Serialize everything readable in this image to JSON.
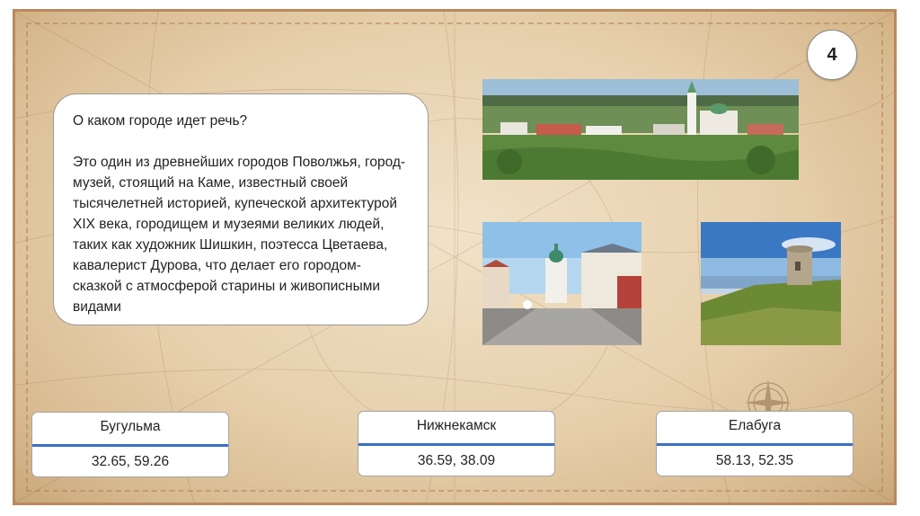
{
  "slide": {
    "number": "4",
    "question": {
      "title": "О каком городе идет речь?",
      "text": "Это один из древнейших городов Поволжья, город-музей, стоящий на Каме, известный своей тысячелетней историей, купеческой архитектурой XIX века, городищем и музеями великих людей, таких как художник Шишкин, поэтесса Цветаева, кавалерист Дурова, что делает его городом-сказкой с атмосферой старины и живописными видами"
    },
    "answers": [
      {
        "name": "Бугульма",
        "coords": "32.65, 59.26"
      },
      {
        "name": "Нижнекамск",
        "coords": "36.59, 38.09"
      },
      {
        "name": "Елабуга",
        "coords": "58.13, 52.35"
      }
    ]
  },
  "colors": {
    "background": "#e6cfab",
    "accent_divider": "#3b6fc6",
    "box_border": "#9a9a9a"
  }
}
